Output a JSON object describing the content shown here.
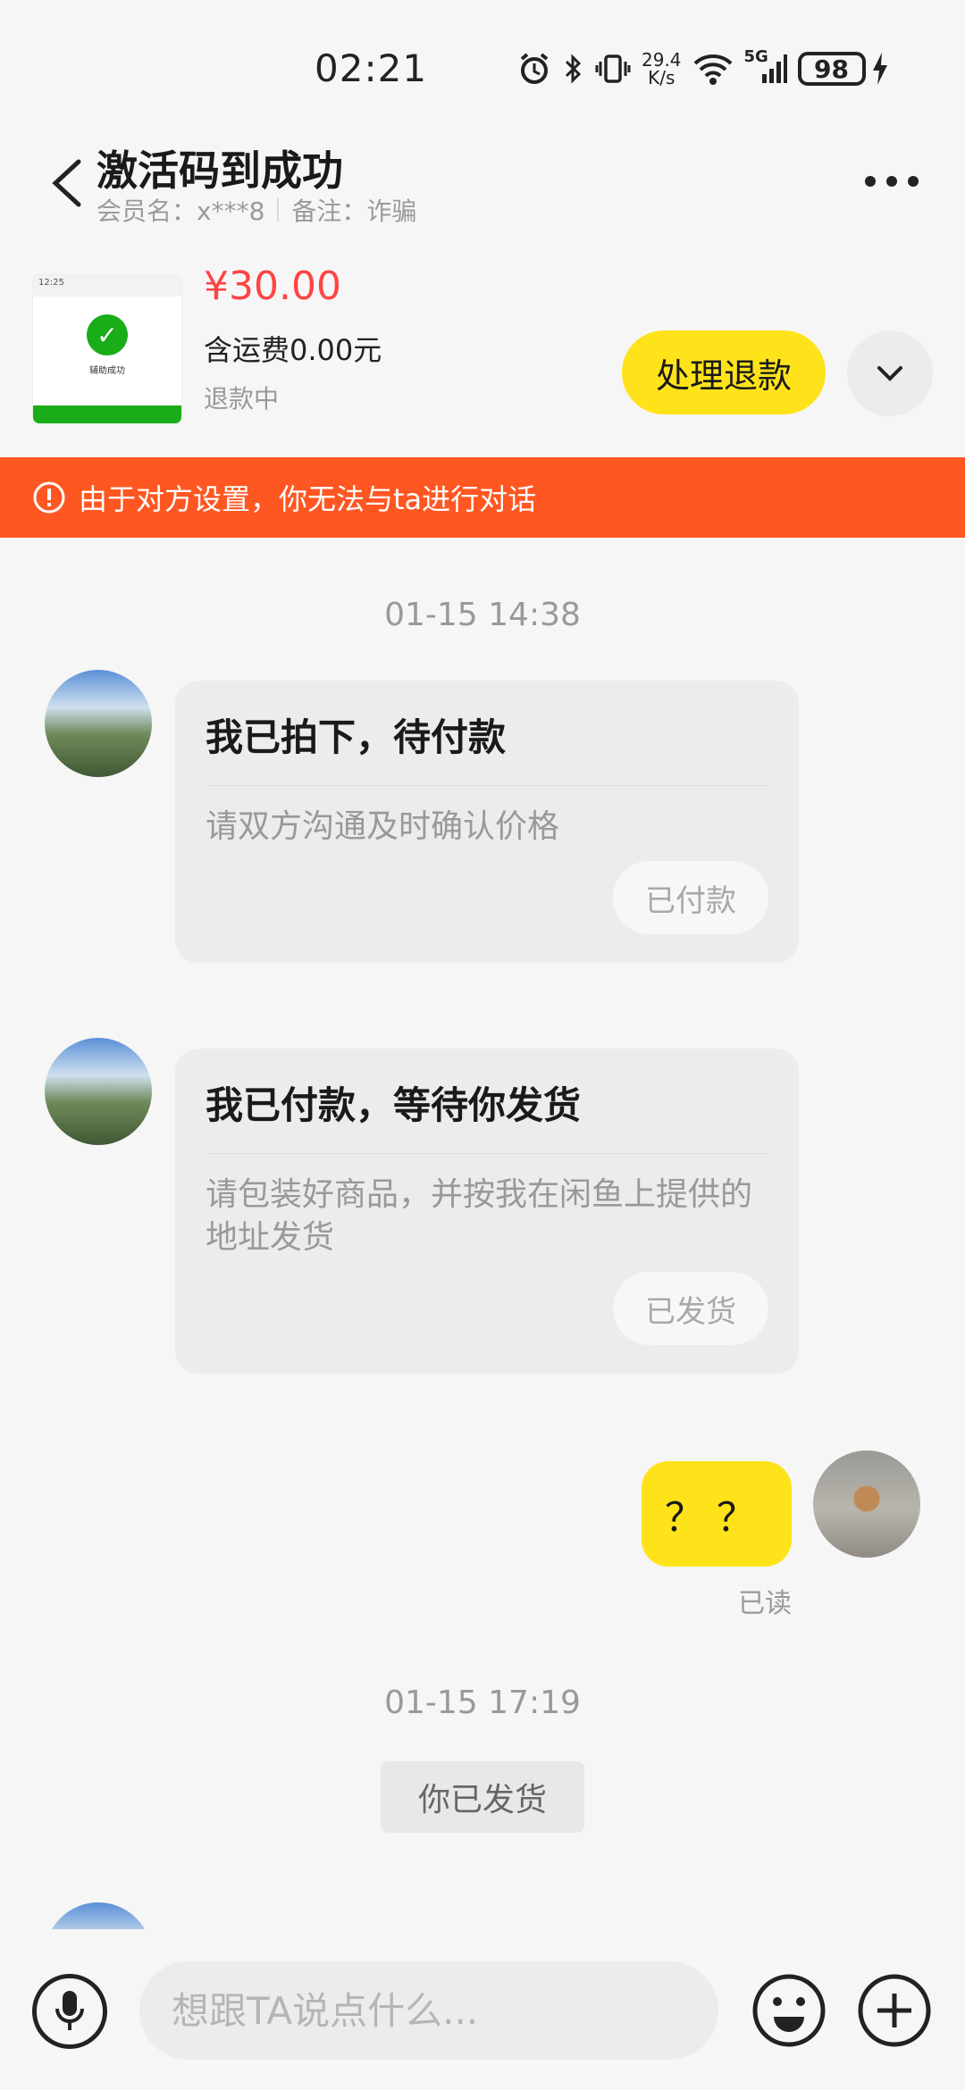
{
  "status_bar": {
    "time": "02:21",
    "net_speed_value": "29.4",
    "net_speed_unit": "K/s",
    "signal_label": "5G",
    "battery": "98"
  },
  "header": {
    "title": "激活码到成功",
    "member_label": "会员名：x***8",
    "note_label": "备注：诈骗"
  },
  "product": {
    "price": "¥30.00",
    "shipping": "含运费0.00元",
    "status": "退款中",
    "refund_button": "处理退款",
    "thumb_top": "12:25",
    "thumb_text": "辅助成功"
  },
  "banner": {
    "text": "由于对方设置，你无法与ta进行对话"
  },
  "messages": {
    "timestamp1": "01-15 14:38",
    "card1": {
      "title": "我已拍下，待付款",
      "desc": "请双方沟通及时确认价格",
      "button": "已付款"
    },
    "card2": {
      "title": "我已付款，等待你发货",
      "desc": "请包装好商品，并按我在闲鱼上提供的地址发货",
      "button": "已发货"
    },
    "my_message": "？？",
    "read_status": "已读",
    "timestamp2": "01-15 17:19",
    "system_message": "你已发货"
  },
  "input": {
    "placeholder": "想跟TA说点什么..."
  },
  "colors": {
    "accent_yellow": "#ffe31a",
    "banner_orange": "#ff5722",
    "price_red": "#ff4444"
  }
}
